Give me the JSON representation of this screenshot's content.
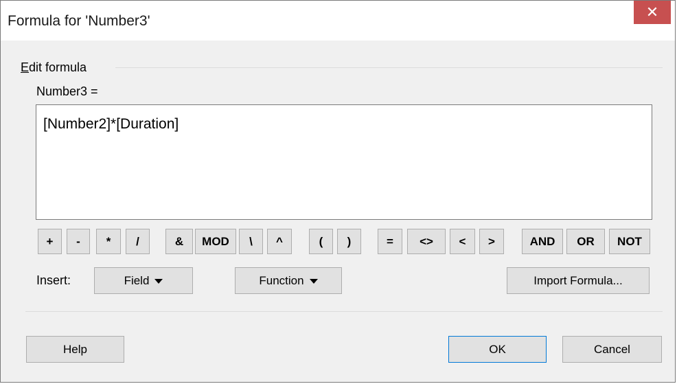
{
  "window": {
    "title": "Formula for 'Number3'",
    "close_glyph": "✕"
  },
  "group": {
    "label_prefix": "E",
    "label_rest": "dit formula"
  },
  "field_label": "Number3 =",
  "formula_value": "[Number2]*[Duration]",
  "operators": [
    "+",
    "-",
    "*",
    "/",
    "&",
    "MOD",
    "\\",
    "^",
    "(",
    ")",
    "=",
    "<>",
    "<",
    ">",
    "AND",
    "OR",
    "NOT"
  ],
  "insert": {
    "label": "Insert:",
    "field_label": "Field",
    "function_label": "Function",
    "import_label": "Import Formula..."
  },
  "footer": {
    "help_label": "Help",
    "ok_label": "OK",
    "cancel_label": "Cancel"
  },
  "colors": {
    "close_bg": "#c75050",
    "default_border": "#0078d7"
  }
}
